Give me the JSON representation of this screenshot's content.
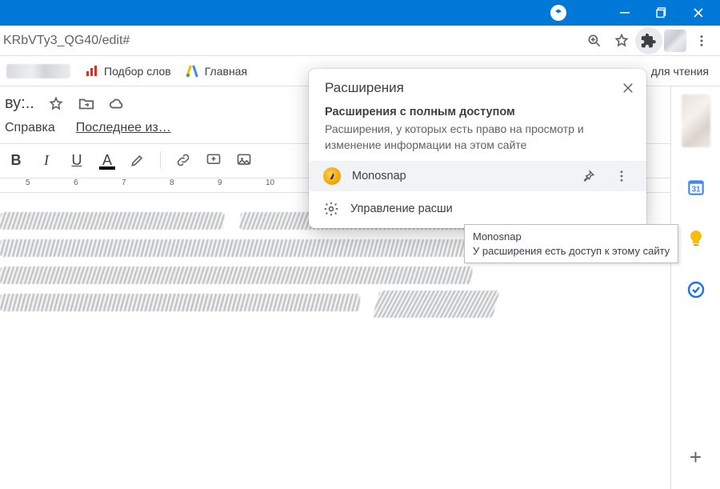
{
  "url_fragment": "KRbVTy3_QG40/edit#",
  "bookmarks": {
    "item1": "Подбор слов",
    "item2": "Главная",
    "reading": "для чтения"
  },
  "docs": {
    "title_suffix": "ву:..",
    "menu_help": "Справка",
    "last_modified": "Последнее из…",
    "ruler": {
      "n5": "5",
      "n6": "6",
      "n7": "7",
      "n8": "8",
      "n9": "9",
      "n10": "10"
    },
    "format": {
      "bold": "B",
      "italic": "I",
      "underline": "U",
      "color": "A"
    }
  },
  "popup": {
    "title": "Расширения",
    "subtitle": "Расширения с полным доступом",
    "desc": "Расширения, у которых есть право на просмотр и изменение информации на этом сайте",
    "ext_name": "Monosnap",
    "manage": "Управление расши"
  },
  "tooltip": {
    "title": "Monosnap",
    "body": "У расширения есть доступ к этому сайту"
  }
}
